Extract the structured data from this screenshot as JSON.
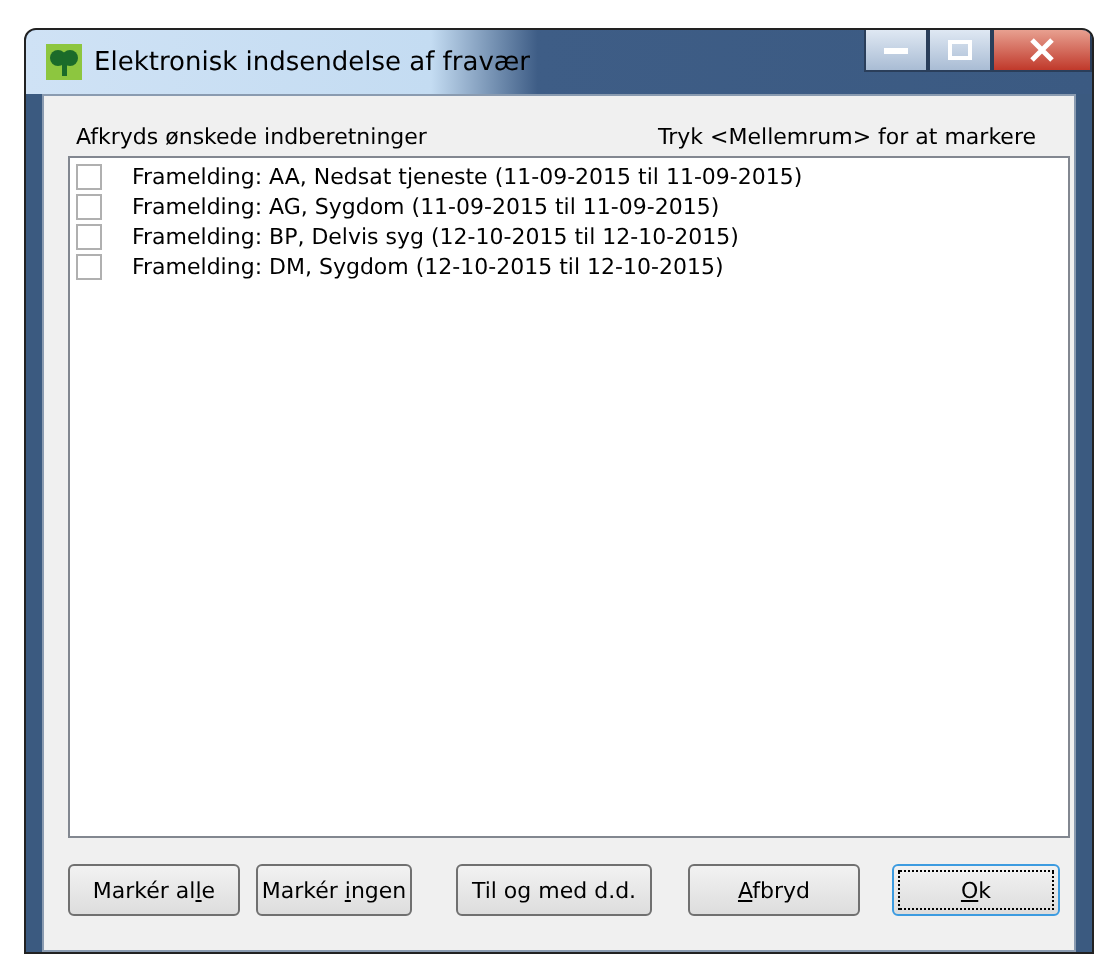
{
  "window": {
    "title": "Elektronisk indsendelse af fravær"
  },
  "instruction": "Afkryds ønskede indberetninger",
  "hint": "Tryk <Mellemrum> for at markere",
  "items": [
    {
      "label": "Framelding: AA, Nedsat tjeneste (11-09-2015 til 11-09-2015)",
      "checked": false
    },
    {
      "label": "Framelding: AG, Sygdom (11-09-2015 til 11-09-2015)",
      "checked": false
    },
    {
      "label": "Framelding: BP, Delvis syg (12-10-2015 til 12-10-2015)",
      "checked": false
    },
    {
      "label": "Framelding: DM, Sygdom (12-10-2015 til 12-10-2015)",
      "checked": false
    }
  ],
  "buttons": [
    {
      "before": "Markér al",
      "mnemonic": "l",
      "after": "e",
      "default": false
    },
    {
      "before": "Markér ",
      "mnemonic": "i",
      "after": "ngen",
      "default": false
    },
    {
      "before": "Til og med d.d.",
      "default": false
    },
    {
      "mnemonic": "A",
      "after": "fbryd",
      "default": false
    },
    {
      "mnemonic": "O",
      "after": "k",
      "default": true
    }
  ]
}
